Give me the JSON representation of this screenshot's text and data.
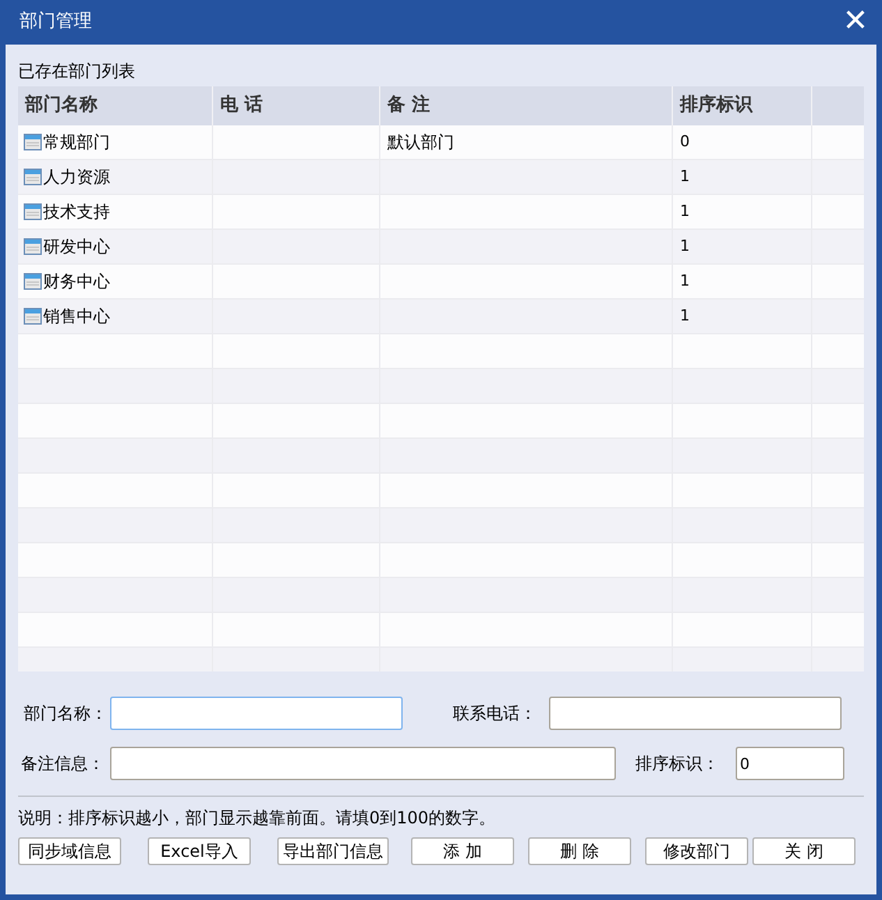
{
  "window": {
    "title": "部门管理",
    "close": "✕"
  },
  "list_label": "已存在部门列表",
  "table": {
    "columns": [
      "部门名称",
      "电 话",
      "备 注",
      "排序标识"
    ],
    "rows": [
      {
        "name": "常规部门",
        "note": "默认部门",
        "order": "0"
      },
      {
        "name": "人力资源",
        "order": "1"
      },
      {
        "name": "技术支持",
        "order": "1"
      },
      {
        "name": "研发中心",
        "order": "1"
      },
      {
        "name": "财务中心",
        "order": "1"
      },
      {
        "name": "销售中心",
        "order": "1"
      }
    ]
  },
  "form": [
    {
      "label": "部门名称：",
      "focused": true
    },
    {
      "label": "联系电话：",
      "focused": false
    },
    {
      "label": "备注信息：",
      "focused": false
    },
    {
      "label": "排序标识：",
      "value": "0",
      "focused": false
    }
  ],
  "hint": "说明：排序标识越小，部门显示越靠前面。请填0到100的数字。",
  "buttons": [
    "同步域信息",
    "Excel导入",
    "导出部门信息",
    "添 加",
    "删 除",
    "修改部门",
    "关 闭"
  ]
}
